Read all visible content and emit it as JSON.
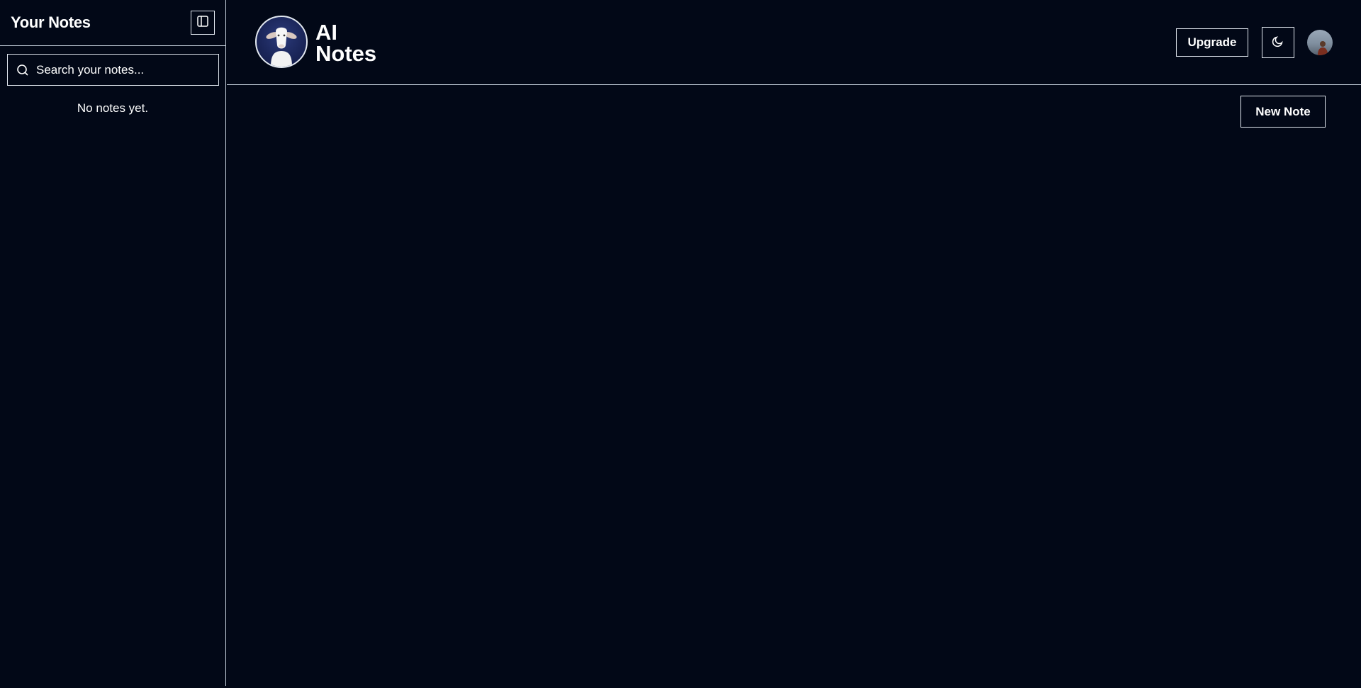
{
  "sidebar": {
    "title": "Your Notes",
    "toggle_icon": "sidebar-panel-icon",
    "search": {
      "placeholder": "Search your notes...",
      "value": "",
      "icon": "search-icon"
    },
    "empty_text": "No notes yet."
  },
  "header": {
    "logo": "goat-logo",
    "brand_line1": "AI",
    "brand_line2": "Notes",
    "upgrade_label": "Upgrade",
    "theme_icon": "moon-icon",
    "avatar": "user-avatar"
  },
  "main": {
    "new_note_label": "New Note"
  },
  "colors": {
    "background": "#020817",
    "border": "#e2e8f0",
    "text": "#ffffff"
  }
}
